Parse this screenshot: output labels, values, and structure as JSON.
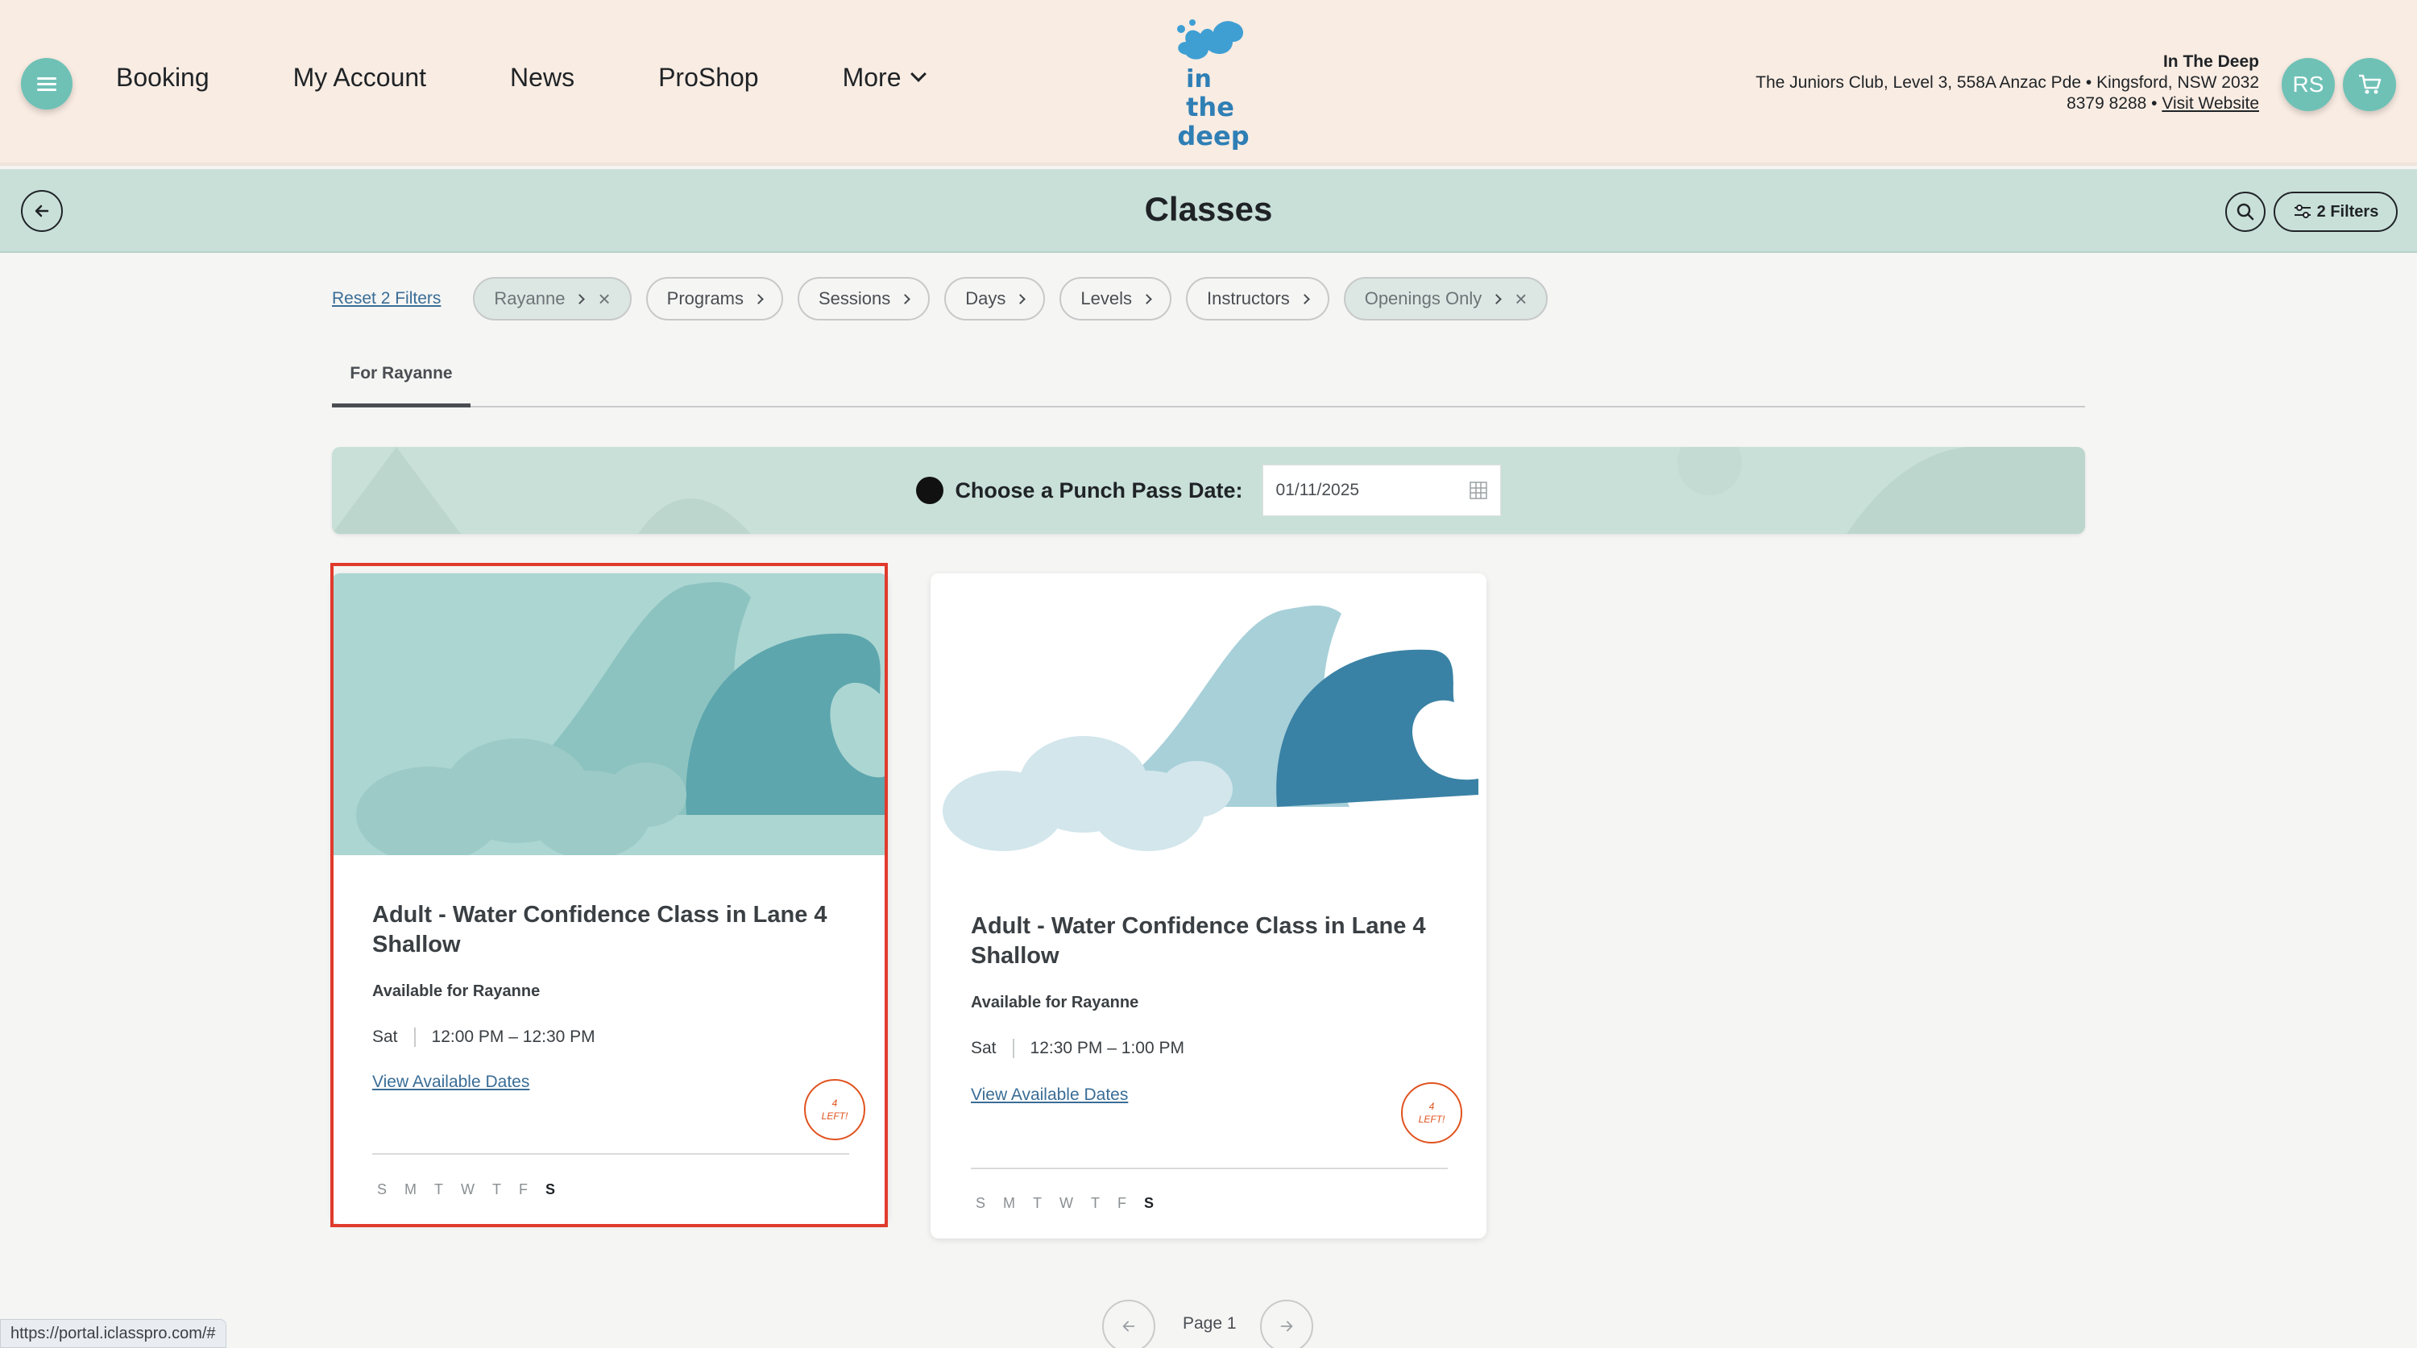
{
  "header": {
    "nav": [
      {
        "label": "Booking"
      },
      {
        "label": "My Account"
      },
      {
        "label": "News"
      },
      {
        "label": "ProShop"
      },
      {
        "label": "More"
      }
    ],
    "logo_text": "In the deep",
    "club_name": "In The Deep",
    "club_address": "The Juniors Club, Level 3, 558A Anzac Pde • Kingsford, NSW 2032",
    "club_phone": "8379 8288 •",
    "club_link": "Visit Website",
    "avatar_initials": "RS"
  },
  "subheader": {
    "title": "Classes",
    "filters_label": "2 Filters"
  },
  "filters": {
    "reset_label": "Reset 2 Filters",
    "chips": [
      {
        "label": "Rayanne",
        "active": true
      },
      {
        "label": "Programs",
        "active": false
      },
      {
        "label": "Sessions",
        "active": false
      },
      {
        "label": "Days",
        "active": false
      },
      {
        "label": "Levels",
        "active": false
      },
      {
        "label": "Instructors",
        "active": false
      },
      {
        "label": "Openings Only",
        "active": true
      }
    ]
  },
  "tabs": [
    {
      "label": "For Rayanne"
    }
  ],
  "punch_pass": {
    "label": "Choose a Punch Pass Date:",
    "date_value": "01/11/2025"
  },
  "cards": [
    {
      "title": "Adult - Water Confidence Class in Lane 4 Shallow",
      "availability": "Available for Rayanne",
      "day": "Sat",
      "time": "12:00 PM – 12:30 PM",
      "link": "View Available Dates",
      "badge_count": "4",
      "badge_text": "LEFT!",
      "days": [
        "S",
        "M",
        "T",
        "W",
        "T",
        "F",
        "S"
      ]
    },
    {
      "title": "Adult - Water Confidence Class in Lane 4 Shallow",
      "availability": "Available for Rayanne",
      "day": "Sat",
      "time": "12:30 PM – 1:00 PM",
      "link": "View Available Dates",
      "badge_count": "4",
      "badge_text": "LEFT!",
      "days": [
        "S",
        "M",
        "T",
        "W",
        "T",
        "F",
        "S"
      ]
    }
  ],
  "pagination": {
    "label": "Page 1"
  },
  "status_bar": {
    "url": "https://portal.iclasspro.com/#"
  },
  "colors": {
    "accent": "#6fc1b6",
    "header_bg": "#f9ece3",
    "subheader_bg": "#c9e0d9",
    "badge": "#e0531f",
    "link": "#3a6d96",
    "highlight": "#e03a2c"
  }
}
